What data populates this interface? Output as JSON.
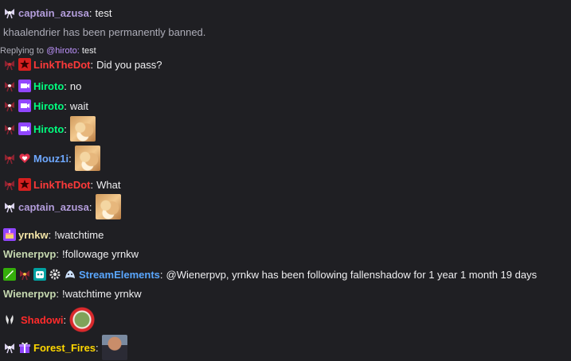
{
  "colors": {
    "background": "#1f1f23",
    "captain_azusa": "#b39ddb",
    "linkthedot": "#ff3a3a",
    "hiroto": "#00ff7f",
    "mouz1i": "#6ea8ff",
    "yrnkw": "#f5e6a8",
    "wienerpvp": "#c6d9b0",
    "streamelements": "#5aa7ff",
    "shadowi": "#ff2b2b",
    "forest_fires": "#ffd700"
  },
  "messages": [
    {
      "user": "captain_azusa",
      "sep": ":",
      "text": "test"
    },
    {
      "system": "khaalendrier has been permanently banned."
    },
    {
      "reply_prefix": "Replying to",
      "reply_to": "@hiroto:",
      "reply_text": "test"
    },
    {
      "user": "LinkTheDot",
      "sep": ":",
      "text": "Did you pass?"
    },
    {
      "user": "Hiroto",
      "sep": ":",
      "text": "no"
    },
    {
      "user": "Hiroto",
      "sep": ":",
      "text": "wait"
    },
    {
      "user": "Hiroto",
      "sep": ":",
      "emote": "cat-emote"
    },
    {
      "user": "Mouz1i",
      "sep": ":",
      "emote": "cat-emote"
    },
    {
      "user": "LinkTheDot",
      "sep": ":",
      "text": "What"
    },
    {
      "user": "captain_azusa",
      "sep": ":",
      "emote": "cat-emote"
    },
    {
      "user": "yrnkw",
      "sep": ":",
      "text": "!watchtime"
    },
    {
      "user": "Wienerpvp",
      "sep": ":",
      "text": "!followage yrnkw"
    },
    {
      "user": "StreamElements",
      "sep": ":",
      "text": "@Wienerpvp, yrnkw has been following fallenshadow for 1 year 1 month 19 days"
    },
    {
      "user": "Wienerpvp",
      "sep": ":",
      "text": "!watchtime yrnkw"
    },
    {
      "user": "Shadowi",
      "sep": ":",
      "emote": "nope-emote"
    },
    {
      "user": "Forest_Fires",
      "sep": ":",
      "emote": "face-emote"
    }
  ]
}
